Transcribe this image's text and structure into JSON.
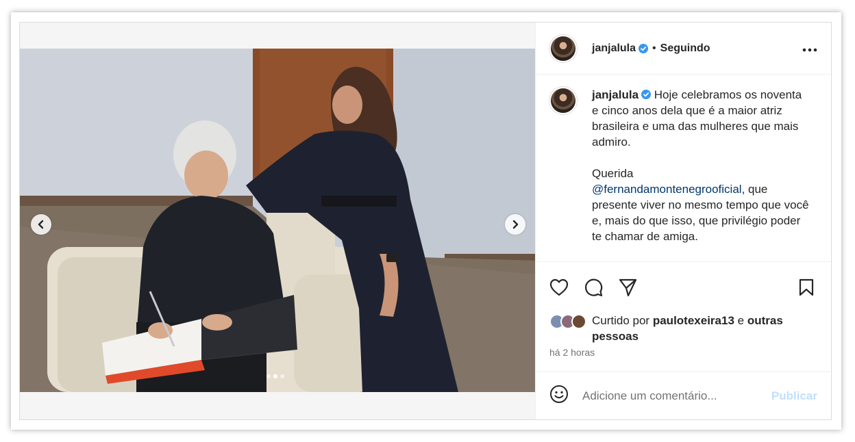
{
  "post": {
    "author": {
      "username": "janjalula",
      "verified": true,
      "follow_status": "Seguindo",
      "separator": "•"
    },
    "media": {
      "carousel_count": 3,
      "active_index": 1
    },
    "caption": {
      "username": "janjalula",
      "paragraph1": "Hoje celebramos os noventa e cinco anos dela que é a maior atriz brasileira e uma das mulheres que mais admiro.",
      "paragraph2_before": "Querida",
      "mention": "@fernandamontenegrooficial",
      "paragraph2_after": ", que presente viver no mesmo tempo que você e, mais do que isso, que privilégio poder te chamar de amiga."
    },
    "likes": {
      "prefix": "Curtido por",
      "user": "paulotexeira13",
      "conjunction": "e",
      "others": "outras pessoas"
    },
    "timestamp": "há 2 horas",
    "comment": {
      "placeholder": "Adicione um comentário...",
      "publish_label": "Publicar"
    }
  },
  "colors": {
    "verified_blue": "#3897f0",
    "publish_disabled": "#c0dffd",
    "mention": "#00376b",
    "secondary_text": "#737373"
  },
  "icons": [
    "chevron-left-icon",
    "chevron-right-icon",
    "more-options-icon",
    "heart-icon",
    "comment-icon",
    "share-icon",
    "bookmark-icon",
    "emoji-icon",
    "verified-badge-icon"
  ]
}
